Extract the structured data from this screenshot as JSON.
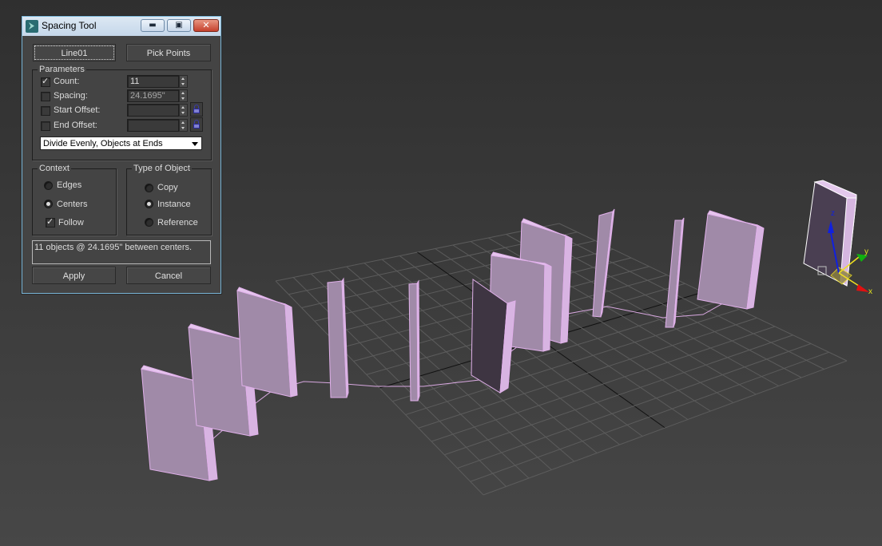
{
  "window": {
    "title": "Spacing Tool",
    "minimize_icon": "minimize-icon",
    "maximize_icon": "maximize-icon",
    "close_icon": "close-icon",
    "minimize_glyph": "▬",
    "maximize_glyph": "▣",
    "close_glyph": "✕"
  },
  "path_buttons": {
    "path_label": "Line01",
    "pick_points_label": "Pick Points"
  },
  "parameters": {
    "group_label": "Parameters",
    "count": {
      "label": "Count:",
      "checked": true,
      "value": "11"
    },
    "spacing": {
      "label": "Spacing:",
      "checked": false,
      "value": "24.1695\""
    },
    "start_offset": {
      "label": "Start Offset:",
      "checked": false,
      "value": ""
    },
    "end_offset": {
      "label": "End Offset:",
      "checked": false,
      "value": ""
    },
    "distribution": {
      "selected": "Divide Evenly, Objects at Ends"
    }
  },
  "context": {
    "group_label": "Context",
    "options": [
      {
        "label": "Edges",
        "selected": false
      },
      {
        "label": "Centers",
        "selected": true
      }
    ],
    "follow": {
      "label": "Follow",
      "checked": true
    }
  },
  "type_of_object": {
    "group_label": "Type of Object",
    "options": [
      {
        "label": "Copy",
        "selected": false
      },
      {
        "label": "Instance",
        "selected": true
      },
      {
        "label": "Reference",
        "selected": false
      }
    ]
  },
  "status_text": "11 objects @ 24.1695\"  between centers.",
  "actions": {
    "apply_label": "Apply",
    "cancel_label": "Cancel"
  },
  "viewport": {
    "background": "#3b3b3b",
    "grid_color": "#5a5a5a",
    "object_color": "#d8a8e0",
    "gizmo_axes": {
      "x_label": "x",
      "y_label": "y",
      "z_label": "z"
    },
    "colors": {
      "x": "#e01010",
      "y": "#10b010",
      "z": "#1020e0",
      "plane": "#f0e020"
    }
  }
}
